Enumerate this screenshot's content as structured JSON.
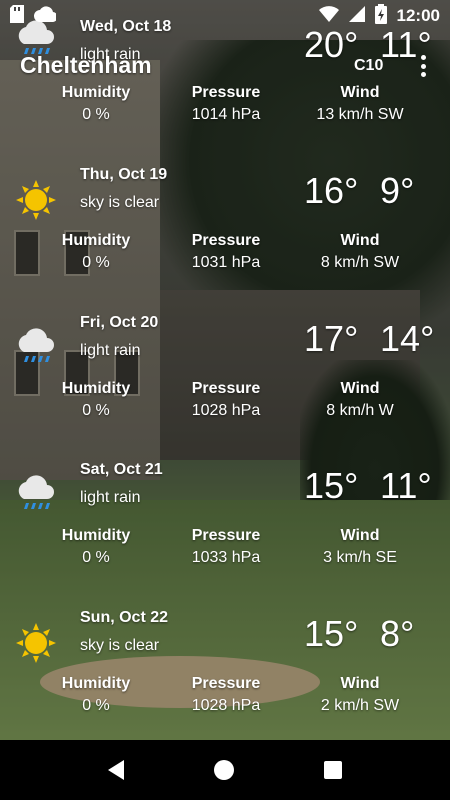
{
  "status_bar": {
    "time": "12:00",
    "icons": [
      "sd-card-icon",
      "cloud-icon",
      "wifi-icon",
      "signal-icon",
      "battery-charging-icon"
    ]
  },
  "toolbar": {
    "city": "Cheltenham",
    "code": "C10",
    "menu_icon": "more-vert-icon"
  },
  "forecast": [
    {
      "date": "Wed, Oct 18",
      "condition": "light rain",
      "icon": "rain-cloud-icon",
      "max": "20°",
      "min": "11°",
      "humidity_label": "Humidity",
      "humidity": "0 %",
      "pressure_label": "Pressure",
      "pressure": "1014 hPa",
      "wind_label": "Wind",
      "wind": "13 km/h SW"
    },
    {
      "date": "Thu, Oct 19",
      "condition": "sky is clear",
      "icon": "sun-icon",
      "max": "16°",
      "min": "9°",
      "humidity_label": "Humidity",
      "humidity": "0 %",
      "pressure_label": "Pressure",
      "pressure": "1031 hPa",
      "wind_label": "Wind",
      "wind": "8 km/h SW"
    },
    {
      "date": "Fri, Oct 20",
      "condition": "light rain",
      "icon": "rain-cloud-icon",
      "max": "17°",
      "min": "14°",
      "humidity_label": "Humidity",
      "humidity": "0 %",
      "pressure_label": "Pressure",
      "pressure": "1028 hPa",
      "wind_label": "Wind",
      "wind": "8 km/h W"
    },
    {
      "date": "Sat, Oct 21",
      "condition": "light rain",
      "icon": "rain-cloud-icon",
      "max": "15°",
      "min": "11°",
      "humidity_label": "Humidity",
      "humidity": "0 %",
      "pressure_label": "Pressure",
      "pressure": "1033 hPa",
      "wind_label": "Wind",
      "wind": "3 km/h SE"
    },
    {
      "date": "Sun, Oct 22",
      "condition": "sky is clear",
      "icon": "sun-icon",
      "max": "15°",
      "min": "8°",
      "humidity_label": "Humidity",
      "humidity": "0 %",
      "pressure_label": "Pressure",
      "pressure": "1028 hPa",
      "wind_label": "Wind",
      "wind": "2 km/h SW"
    }
  ],
  "colors": {
    "text": "#ffffff",
    "sun": "#f5c400",
    "cloud": "#e8e8e8",
    "rain": "#2f8fe0",
    "navbar": "#000000"
  }
}
